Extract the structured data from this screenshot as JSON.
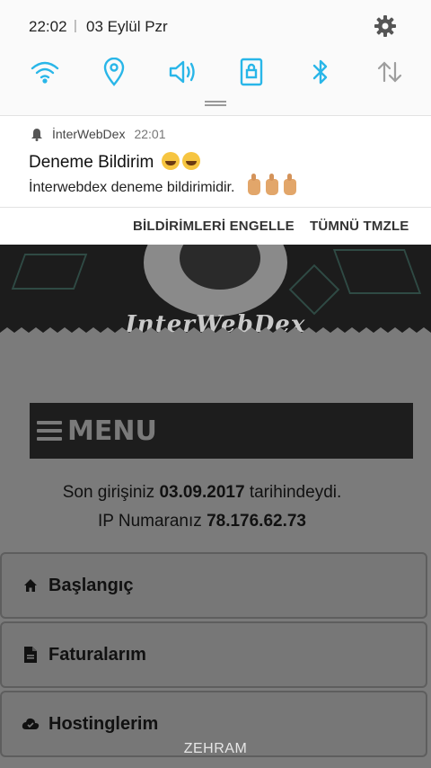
{
  "status": {
    "time": "22:02",
    "separator": "|",
    "date": "03 Eylül Pzr"
  },
  "quick_settings": [
    {
      "icon": "wifi-icon",
      "active": true
    },
    {
      "icon": "location-icon",
      "active": true
    },
    {
      "icon": "sound-icon",
      "active": true
    },
    {
      "icon": "screen-lock-icon",
      "active": true
    },
    {
      "icon": "bluetooth-icon",
      "active": true
    },
    {
      "icon": "data-sync-icon",
      "active": false
    }
  ],
  "notification": {
    "app_name": "İnterWebDex",
    "time": "22:01",
    "title": "Deneme Bildirim",
    "body": "İnterwebdex deneme bildirimidir."
  },
  "actions": {
    "block": "BİLDİRİMLERİ ENGELLE",
    "clear": "TÜMNÜ TMZLE"
  },
  "page": {
    "banner_title": "InterWebDex",
    "menu_label": "MENU",
    "login_prefix": "Son girişiniz",
    "login_date": "03.09.2017",
    "login_suffix": "tarihindeydi.",
    "ip_prefix": "IP Numaranız",
    "ip_value": "78.176.62.73",
    "nav": [
      {
        "label": "Başlangıç",
        "icon": "home-icon"
      },
      {
        "label": "Faturalarım",
        "icon": "document-icon"
      },
      {
        "label": "Hostinglerim",
        "icon": "cloud-icon"
      }
    ],
    "footer": "ZEHRAM"
  },
  "colors": {
    "accent": "#29b6e8",
    "inactive": "#9e9e9e",
    "menu_bg": "#1d1d1d"
  }
}
